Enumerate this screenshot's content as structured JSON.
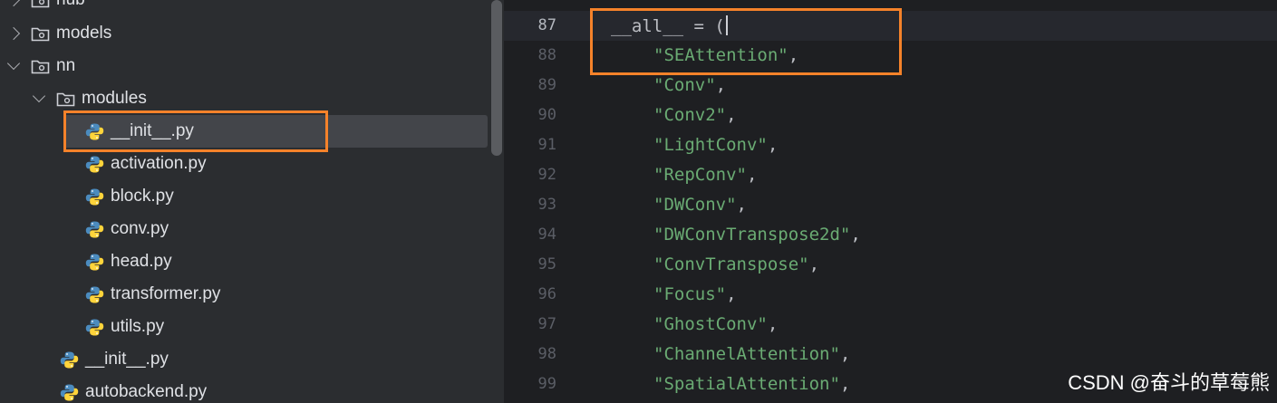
{
  "tree": {
    "items": [
      {
        "label": "hub",
        "kind": "folder",
        "depth": 0,
        "expanded": false
      },
      {
        "label": "models",
        "kind": "folder",
        "depth": 0,
        "expanded": false
      },
      {
        "label": "nn",
        "kind": "folder",
        "depth": 0,
        "expanded": true
      },
      {
        "label": "modules",
        "kind": "folder",
        "depth": 1,
        "expanded": true
      },
      {
        "label": "__init__.py",
        "kind": "python",
        "depth": 2,
        "selected": true
      },
      {
        "label": "activation.py",
        "kind": "python",
        "depth": 2
      },
      {
        "label": "block.py",
        "kind": "python",
        "depth": 2
      },
      {
        "label": "conv.py",
        "kind": "python",
        "depth": 2
      },
      {
        "label": "head.py",
        "kind": "python",
        "depth": 2
      },
      {
        "label": "transformer.py",
        "kind": "python",
        "depth": 2
      },
      {
        "label": "utils.py",
        "kind": "python",
        "depth": 2
      },
      {
        "label": "__init__.py",
        "kind": "python",
        "depth": 1
      },
      {
        "label": "autobackend.py",
        "kind": "python",
        "depth": 1
      }
    ]
  },
  "editor": {
    "current_line": 87,
    "lines": [
      {
        "num": "87",
        "text": "__all__ = (",
        "kind": "code"
      },
      {
        "num": "88",
        "text": "\"SEAttention\"",
        "kind": "string"
      },
      {
        "num": "89",
        "text": "\"Conv\"",
        "kind": "string"
      },
      {
        "num": "90",
        "text": "\"Conv2\"",
        "kind": "string"
      },
      {
        "num": "91",
        "text": "\"LightConv\"",
        "kind": "string"
      },
      {
        "num": "92",
        "text": "\"RepConv\"",
        "kind": "string"
      },
      {
        "num": "93",
        "text": "\"DWConv\"",
        "kind": "string"
      },
      {
        "num": "94",
        "text": "\"DWConvTranspose2d\"",
        "kind": "string"
      },
      {
        "num": "95",
        "text": "\"ConvTranspose\"",
        "kind": "string"
      },
      {
        "num": "96",
        "text": "\"Focus\"",
        "kind": "string"
      },
      {
        "num": "97",
        "text": "\"GhostConv\"",
        "kind": "string"
      },
      {
        "num": "98",
        "text": "\"ChannelAttention\"",
        "kind": "string"
      },
      {
        "num": "99",
        "text": "\"SpatialAttention\"",
        "kind": "string"
      }
    ]
  },
  "colors": {
    "highlight": "#f5822a",
    "string": "#6aab73",
    "tree_bg": "#2b2d30",
    "editor_bg": "#1e1f22"
  },
  "watermark": "CSDN @奋斗的草莓熊"
}
